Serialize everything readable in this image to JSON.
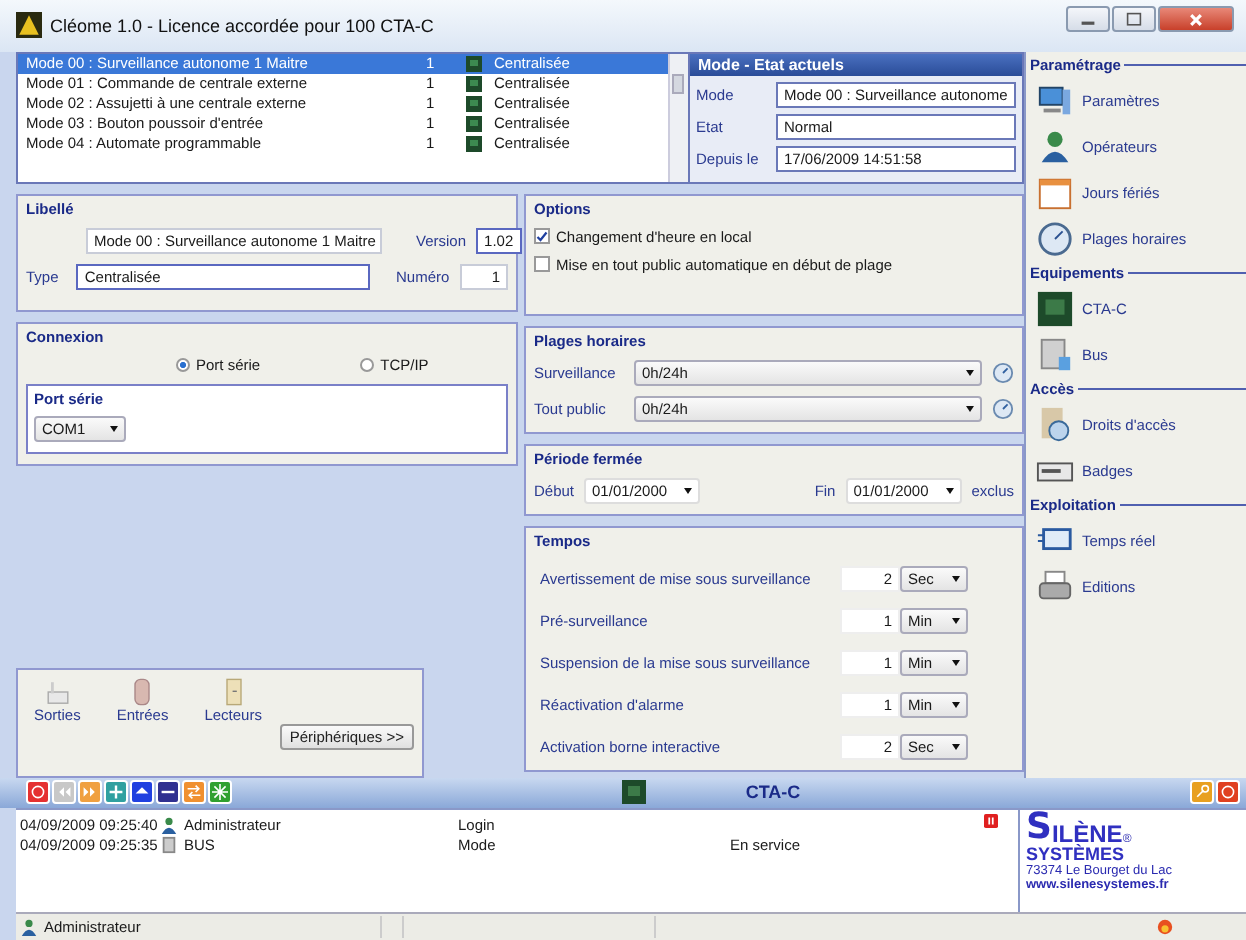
{
  "window": {
    "title": "Cléome 1.0 - Licence accordée pour 100 CTA-C"
  },
  "modes_list": {
    "rows": [
      {
        "name": "Mode 00 : Surveillance autonome 1 Maitre",
        "number": "1",
        "status": "Centralisée",
        "selected": true
      },
      {
        "name": "Mode 01 : Commande de centrale externe",
        "number": "1",
        "status": "Centralisée",
        "selected": false
      },
      {
        "name": "Mode 02 : Assujetti à une centrale externe",
        "number": "1",
        "status": "Centralisée",
        "selected": false
      },
      {
        "name": "Mode 03 : Bouton poussoir d'entrée",
        "number": "1",
        "status": "Centralisée",
        "selected": false
      },
      {
        "name": "Mode 04 : Automate programmable",
        "number": "1",
        "status": "Centralisée",
        "selected": false
      }
    ]
  },
  "current_state": {
    "title": "Mode - Etat actuels",
    "fields": [
      {
        "label": "Mode",
        "value": "Mode 00 : Surveillance autonome"
      },
      {
        "label": "Etat",
        "value": "Normal"
      },
      {
        "label": "Depuis le",
        "value": "17/06/2009 14:51:58"
      }
    ]
  },
  "libelle": {
    "title": "Libellé",
    "name_value": "Mode 00 : Surveillance autonome 1 Maitre",
    "version_label": "Version",
    "version_value": "1.02",
    "type_label": "Type",
    "type_value": "Centralisée",
    "numero_label": "Numéro",
    "numero_value": "1"
  },
  "options": {
    "title": "Options",
    "checkboxes": [
      {
        "label": "Changement d'heure en local",
        "checked": true
      },
      {
        "label": "Mise en tout public automatique en début de plage",
        "checked": false
      }
    ]
  },
  "connexion": {
    "title": "Connexion",
    "radios": [
      {
        "label": "Port série",
        "selected": true
      },
      {
        "label": "TCP/IP",
        "selected": false
      }
    ],
    "port_title": "Port série",
    "port_value": "COM1"
  },
  "peripherals": {
    "items": [
      {
        "label": "Sorties",
        "kind": "output"
      },
      {
        "label": "Entrées",
        "kind": "input"
      },
      {
        "label": "Lecteurs",
        "kind": "reader"
      }
    ],
    "button": "Périphériques >>"
  },
  "plages": {
    "title": "Plages horaires",
    "rows": [
      {
        "label": "Surveillance",
        "value": "0h/24h"
      },
      {
        "label": "Tout public",
        "value": "0h/24h"
      }
    ]
  },
  "periode": {
    "title": "Période fermée",
    "start_label": "Début",
    "start": "01/01/2000",
    "end_label": "Fin",
    "end": "01/01/2000",
    "suffix": "exclus"
  },
  "tempos": {
    "title": "Tempos",
    "rows": [
      {
        "label": "Avertissement de mise sous surveillance",
        "value": "2",
        "unit": "Sec"
      },
      {
        "label": "Pré-surveillance",
        "value": "1",
        "unit": "Min"
      },
      {
        "label": "Suspension de la mise sous surveillance",
        "value": "1",
        "unit": "Min"
      },
      {
        "label": "Réactivation d'alarme",
        "value": "1",
        "unit": "Min"
      },
      {
        "label": "Activation borne interactive",
        "value": "2",
        "unit": "Sec"
      }
    ]
  },
  "sidebar": {
    "sections": [
      {
        "title": "Paramétrage",
        "items": [
          {
            "label": "Paramètres",
            "kind": "computer"
          },
          {
            "label": "Opérateurs",
            "kind": "user"
          },
          {
            "label": "Jours fériés",
            "kind": "calendar"
          },
          {
            "label": "Plages horaires",
            "kind": "clock"
          }
        ]
      },
      {
        "title": "Equipements",
        "items": [
          {
            "label": "CTA-C",
            "kind": "board"
          },
          {
            "label": "Bus",
            "kind": "device"
          }
        ]
      },
      {
        "title": "Accès",
        "items": [
          {
            "label": "Droits d'accès",
            "kind": "door"
          },
          {
            "label": "Badges",
            "kind": "badge"
          }
        ]
      },
      {
        "title": "Exploitation",
        "items": [
          {
            "label": "Temps réel",
            "kind": "monitor"
          },
          {
            "label": "Editions",
            "kind": "printer"
          }
        ]
      }
    ]
  },
  "toolbar": {
    "title": "CTA-C",
    "buttons": [
      {
        "kind": "power",
        "color": "#e53030"
      },
      {
        "kind": "rewind",
        "color": "#c8c8c8"
      },
      {
        "kind": "forward",
        "color": "#f0a040"
      },
      {
        "kind": "plus",
        "color": "#30a0a0"
      },
      {
        "kind": "eject",
        "color": "#2040e0"
      },
      {
        "kind": "minus",
        "color": "#303090"
      },
      {
        "kind": "swap",
        "color": "#f09030"
      },
      {
        "kind": "burst",
        "color": "#30a030"
      }
    ]
  },
  "log": {
    "rows": [
      {
        "time": "04/09/2009 09:25:40",
        "kind": "user",
        "source": "Administrateur",
        "event": "Login",
        "detail": ""
      },
      {
        "time": "04/09/2009 09:25:35",
        "kind": "device",
        "source": "BUS",
        "event": "Mode",
        "detail": "En service"
      }
    ]
  },
  "logo": {
    "initial_1": "S",
    "rest_1": "ILÈNE",
    "mark": "®",
    "initial_2": "S",
    "rest_2": "YSTÈMES",
    "address": "73374 Le Bourget du Lac",
    "url": "www.silenesystemes.fr"
  },
  "status_bar": {
    "user": "Administrateur"
  }
}
